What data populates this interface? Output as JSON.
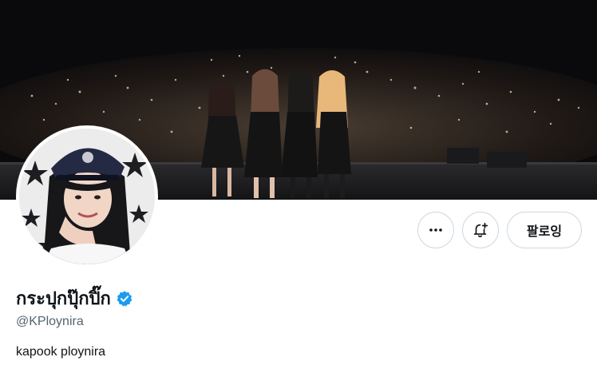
{
  "profile": {
    "display_name": "กระปุกปุ๊กปิ๊ก",
    "handle": "@KPloynira",
    "bio": "kapook ploynira",
    "verified": true
  },
  "actions": {
    "more_icon": "more-horizontal-icon",
    "notify_icon": "bell-plus-icon",
    "follow_label": "팔로잉"
  },
  "colors": {
    "verified_blue": "#1d9bf0",
    "text_primary": "#0f1419",
    "text_secondary": "#536471",
    "border": "#cfd9de"
  }
}
